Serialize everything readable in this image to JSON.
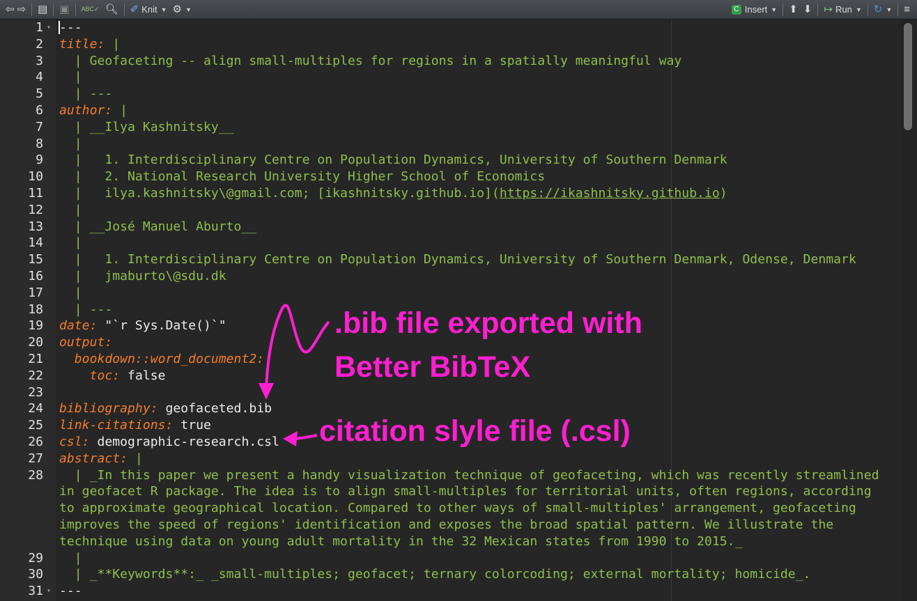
{
  "toolbar": {
    "knit_label": "Knit",
    "insert_label": "Insert",
    "run_label": "Run"
  },
  "editor": {
    "lines": [
      {
        "n": "1",
        "fold": true,
        "parts": [
          [
            "w",
            "---"
          ]
        ]
      },
      {
        "n": "2",
        "parts": [
          [
            "k",
            "title:"
          ],
          [
            "g",
            " |"
          ]
        ]
      },
      {
        "n": "3",
        "parts": [
          [
            "g",
            "  | Geofaceting -- align small-multiples for regions in a spatially meaningful way"
          ]
        ]
      },
      {
        "n": "4",
        "parts": [
          [
            "g",
            "  |"
          ]
        ]
      },
      {
        "n": "5",
        "parts": [
          [
            "g",
            "  | ---"
          ]
        ]
      },
      {
        "n": "6",
        "parts": [
          [
            "k",
            "author:"
          ],
          [
            "g",
            " |"
          ]
        ]
      },
      {
        "n": "7",
        "parts": [
          [
            "g",
            "  | __Ilya Kashnitsky__"
          ]
        ]
      },
      {
        "n": "8",
        "parts": [
          [
            "g",
            "  |"
          ]
        ]
      },
      {
        "n": "9",
        "parts": [
          [
            "g",
            "  |   1. Interdisciplinary Centre on Population Dynamics, University of Southern Denmark"
          ]
        ]
      },
      {
        "n": "10",
        "parts": [
          [
            "g",
            "  |   2. National Research University Higher School of Economics"
          ]
        ]
      },
      {
        "n": "11",
        "parts": [
          [
            "g",
            "  |   ilya.kashnitsky\\@gmail.com; [ikashnitsky.github.io]("
          ],
          [
            "gu",
            "https://ikashnitsky.github.io"
          ],
          [
            "g",
            ")"
          ]
        ]
      },
      {
        "n": "12",
        "parts": [
          [
            "g",
            "  |"
          ]
        ]
      },
      {
        "n": "13",
        "parts": [
          [
            "g",
            "  | __José Manuel Aburto__"
          ]
        ]
      },
      {
        "n": "14",
        "parts": [
          [
            "g",
            "  |"
          ]
        ]
      },
      {
        "n": "15",
        "parts": [
          [
            "g",
            "  |   1. Interdisciplinary Centre on Population Dynamics, University of Southern Denmark, Odense, Denmark"
          ]
        ]
      },
      {
        "n": "16",
        "parts": [
          [
            "g",
            "  |   jmaburto\\@sdu.dk"
          ]
        ]
      },
      {
        "n": "17",
        "parts": [
          [
            "g",
            "  |"
          ]
        ]
      },
      {
        "n": "18",
        "parts": [
          [
            "g",
            "  | ---"
          ]
        ]
      },
      {
        "n": "19",
        "parts": [
          [
            "k",
            "date:"
          ],
          [
            "w",
            " \"`r Sys.Date()`\""
          ]
        ]
      },
      {
        "n": "20",
        "parts": [
          [
            "k",
            "output:"
          ]
        ]
      },
      {
        "n": "21",
        "parts": [
          [
            "k",
            "  bookdown::word_document2:"
          ]
        ]
      },
      {
        "n": "22",
        "parts": [
          [
            "k",
            "    toc:"
          ],
          [
            "w",
            " false"
          ]
        ]
      },
      {
        "n": "23",
        "parts": []
      },
      {
        "n": "24",
        "parts": [
          [
            "k",
            "bibliography:"
          ],
          [
            "w",
            " geofaceted.bib"
          ]
        ]
      },
      {
        "n": "25",
        "parts": [
          [
            "k",
            "link-citations:"
          ],
          [
            "w",
            " true"
          ]
        ]
      },
      {
        "n": "26",
        "parts": [
          [
            "k",
            "csl:"
          ],
          [
            "w",
            " demographic-research.csl"
          ]
        ]
      },
      {
        "n": "27",
        "parts": [
          [
            "k",
            "abstract:"
          ],
          [
            "g",
            " |"
          ]
        ]
      },
      {
        "n": "28",
        "parts": [
          [
            "g",
            "  | _In this paper we present a handy visualization technique of geofaceting, which was recently streamlined"
          ]
        ]
      },
      {
        "n": "",
        "parts": [
          [
            "g",
            "in geofacet R package. The idea is to align small-multiples for territorial units, often regions, according"
          ]
        ]
      },
      {
        "n": "",
        "parts": [
          [
            "g",
            "to approximate geographical location. Compared to other ways of small-multiples' arrangement, geofaceting"
          ]
        ]
      },
      {
        "n": "",
        "parts": [
          [
            "g",
            "improves the speed of regions' identification and exposes the broad spatial pattern. We illustrate the"
          ]
        ]
      },
      {
        "n": "",
        "parts": [
          [
            "g",
            "technique using data on young adult mortality in the 32 Mexican states from 1990 to 2015._"
          ]
        ]
      },
      {
        "n": "29",
        "parts": [
          [
            "g",
            "  |"
          ]
        ]
      },
      {
        "n": "30",
        "parts": [
          [
            "g",
            "  | _**Keywords**:_ _small-multiples; geofacet; ternary colorcoding; external mortality; homicide_."
          ]
        ]
      },
      {
        "n": "31",
        "fold": true,
        "parts": [
          [
            "w",
            "---"
          ]
        ]
      }
    ]
  },
  "annotations": {
    "bib_line1": ".bib file exported with",
    "bib_line2": "Better BibTeX",
    "csl": "citation slyle file (.csl)"
  },
  "colors": {
    "keyword": "#f57d2d",
    "string": "#8fbf4d",
    "annotation": "#ff1fd0",
    "background": "#262626"
  }
}
